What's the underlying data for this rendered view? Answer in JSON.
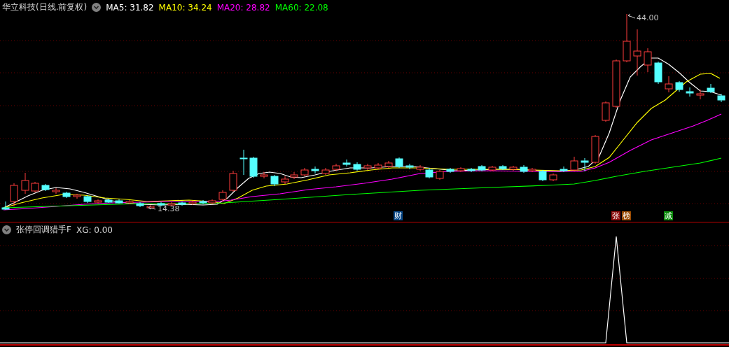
{
  "main_panel": {
    "title": "华立科技(日线.前复权)",
    "indicators": [
      {
        "label": "MA5: 31.82",
        "color": "#ffffff"
      },
      {
        "label": "MA10: 34.24",
        "color": "#ffff00"
      },
      {
        "label": "MA20: 28.82",
        "color": "#ff00ff"
      },
      {
        "label": "MA60: 22.08",
        "color": "#00ff00"
      }
    ],
    "high_label": "44.00",
    "low_label": "14.38",
    "markers": [
      {
        "text": "财",
        "color": "#0a4a8a"
      },
      {
        "text": "张",
        "color": "#8a0a0a"
      },
      {
        "text": "榜",
        "color": "#9a4a00"
      },
      {
        "text": "减",
        "color": "#0a8a0a"
      }
    ]
  },
  "sub_panel": {
    "title": "张停回调猎手F",
    "value": "XG: 0.00"
  }
}
